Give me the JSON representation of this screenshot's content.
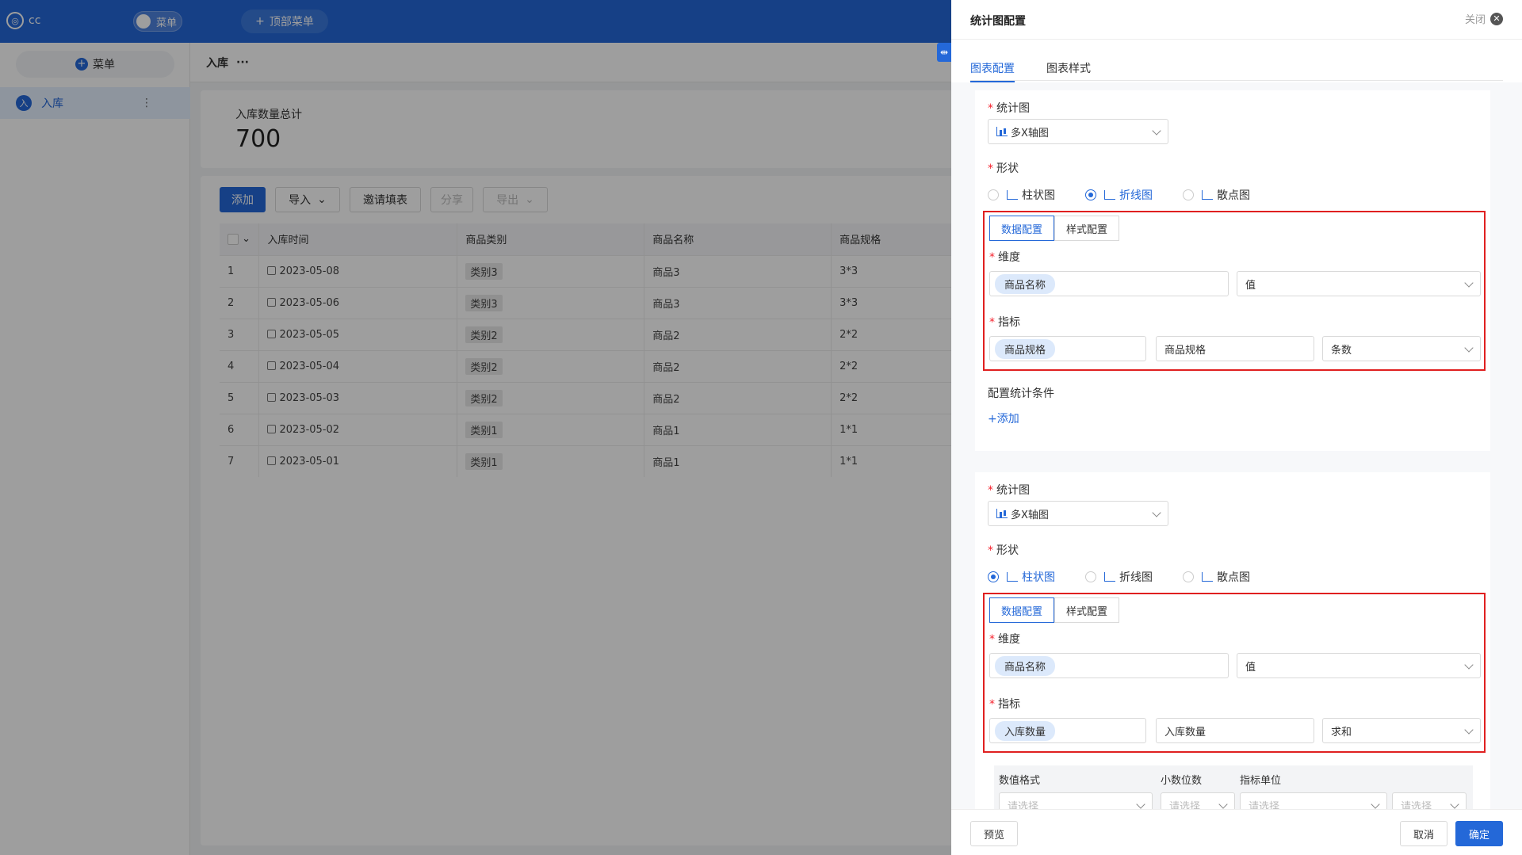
{
  "app": {
    "logo_text": "cc",
    "menu_toggle_label": "菜单",
    "top_menu_label": "顶部菜单",
    "sidebar_menu_label": "菜单",
    "sidebar_item": {
      "avatar": "入",
      "label": "入库"
    },
    "breadcrumb": {
      "title": "入库",
      "more": "···"
    }
  },
  "summary": {
    "label": "入库数量总计",
    "value": "700"
  },
  "toolbar": {
    "add": "添加",
    "import": "导入",
    "invite": "邀请填表",
    "share": "分享",
    "export": "导出"
  },
  "table": {
    "headers": [
      "入库时间",
      "商品类别",
      "商品名称",
      "商品规格"
    ],
    "rows": [
      {
        "no": "1",
        "date": "2023-05-08",
        "category": "类别3",
        "name": "商品3",
        "spec": "3*3"
      },
      {
        "no": "2",
        "date": "2023-05-06",
        "category": "类别3",
        "name": "商品3",
        "spec": "3*3"
      },
      {
        "no": "3",
        "date": "2023-05-05",
        "category": "类别2",
        "name": "商品2",
        "spec": "2*2"
      },
      {
        "no": "4",
        "date": "2023-05-04",
        "category": "类别2",
        "name": "商品2",
        "spec": "2*2"
      },
      {
        "no": "5",
        "date": "2023-05-03",
        "category": "类别2",
        "name": "商品2",
        "spec": "2*2"
      },
      {
        "no": "6",
        "date": "2023-05-02",
        "category": "类别1",
        "name": "商品1",
        "spec": "1*1"
      },
      {
        "no": "7",
        "date": "2023-05-01",
        "category": "类别1",
        "name": "商品1",
        "spec": "1*1"
      }
    ]
  },
  "drawer": {
    "title": "统计图配置",
    "close_label": "关闭",
    "tabs": [
      "图表配置",
      "图表样式"
    ],
    "labels": {
      "chart": "统计图",
      "shape": "形状",
      "dimension": "维度",
      "metric": "指标",
      "condition": "配置统计条件",
      "add": "+添加",
      "data_config": "数据配置",
      "style_config": "样式配置"
    },
    "shapes": [
      "柱状图",
      "折线图",
      "散点图"
    ],
    "section1": {
      "chart_type": "多X轴图",
      "dimension_field": "商品名称",
      "dimension_mode": "值",
      "metric_field": "商品规格",
      "metric_alias": "商品规格",
      "metric_agg": "条数"
    },
    "section2": {
      "chart_type": "多X轴图",
      "dimension_field": "商品名称",
      "dimension_mode": "值",
      "metric_field": "入库数量",
      "metric_alias": "入库数量",
      "metric_agg": "求和"
    },
    "format": {
      "number_format": "数值格式",
      "decimals": "小数位数",
      "unit": "指标单位",
      "placeholder": "请选择"
    },
    "footer": {
      "preview": "预览",
      "cancel": "取消",
      "ok": "确定"
    }
  }
}
